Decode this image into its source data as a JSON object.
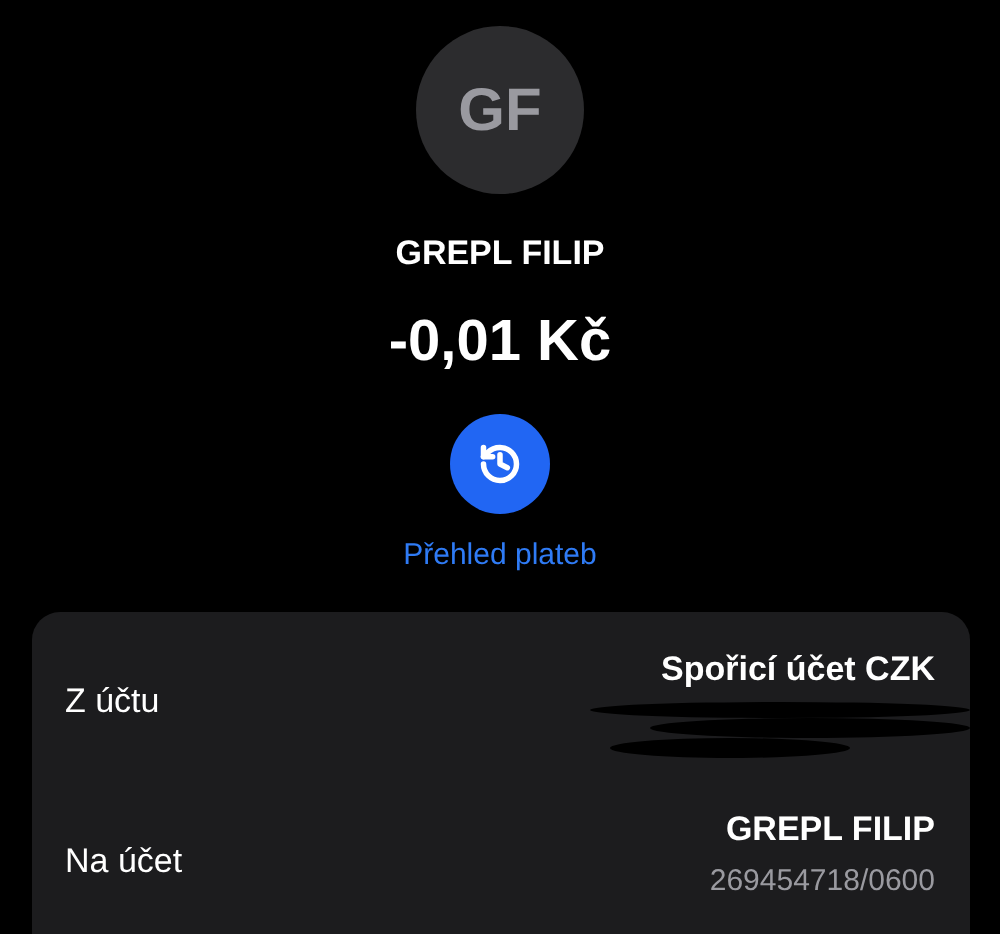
{
  "contact": {
    "initials": "GF",
    "name": "GREPL FILIP"
  },
  "amount": "-0,01 Kč",
  "history_link": "Přehled plateb",
  "details": [
    {
      "label": "Z účtu",
      "value": "Spořicí účet CZK",
      "redacted": true
    },
    {
      "label": "Na účet",
      "value": "GREPL FILIP",
      "account": "269454718/0600",
      "redacted": false
    }
  ]
}
